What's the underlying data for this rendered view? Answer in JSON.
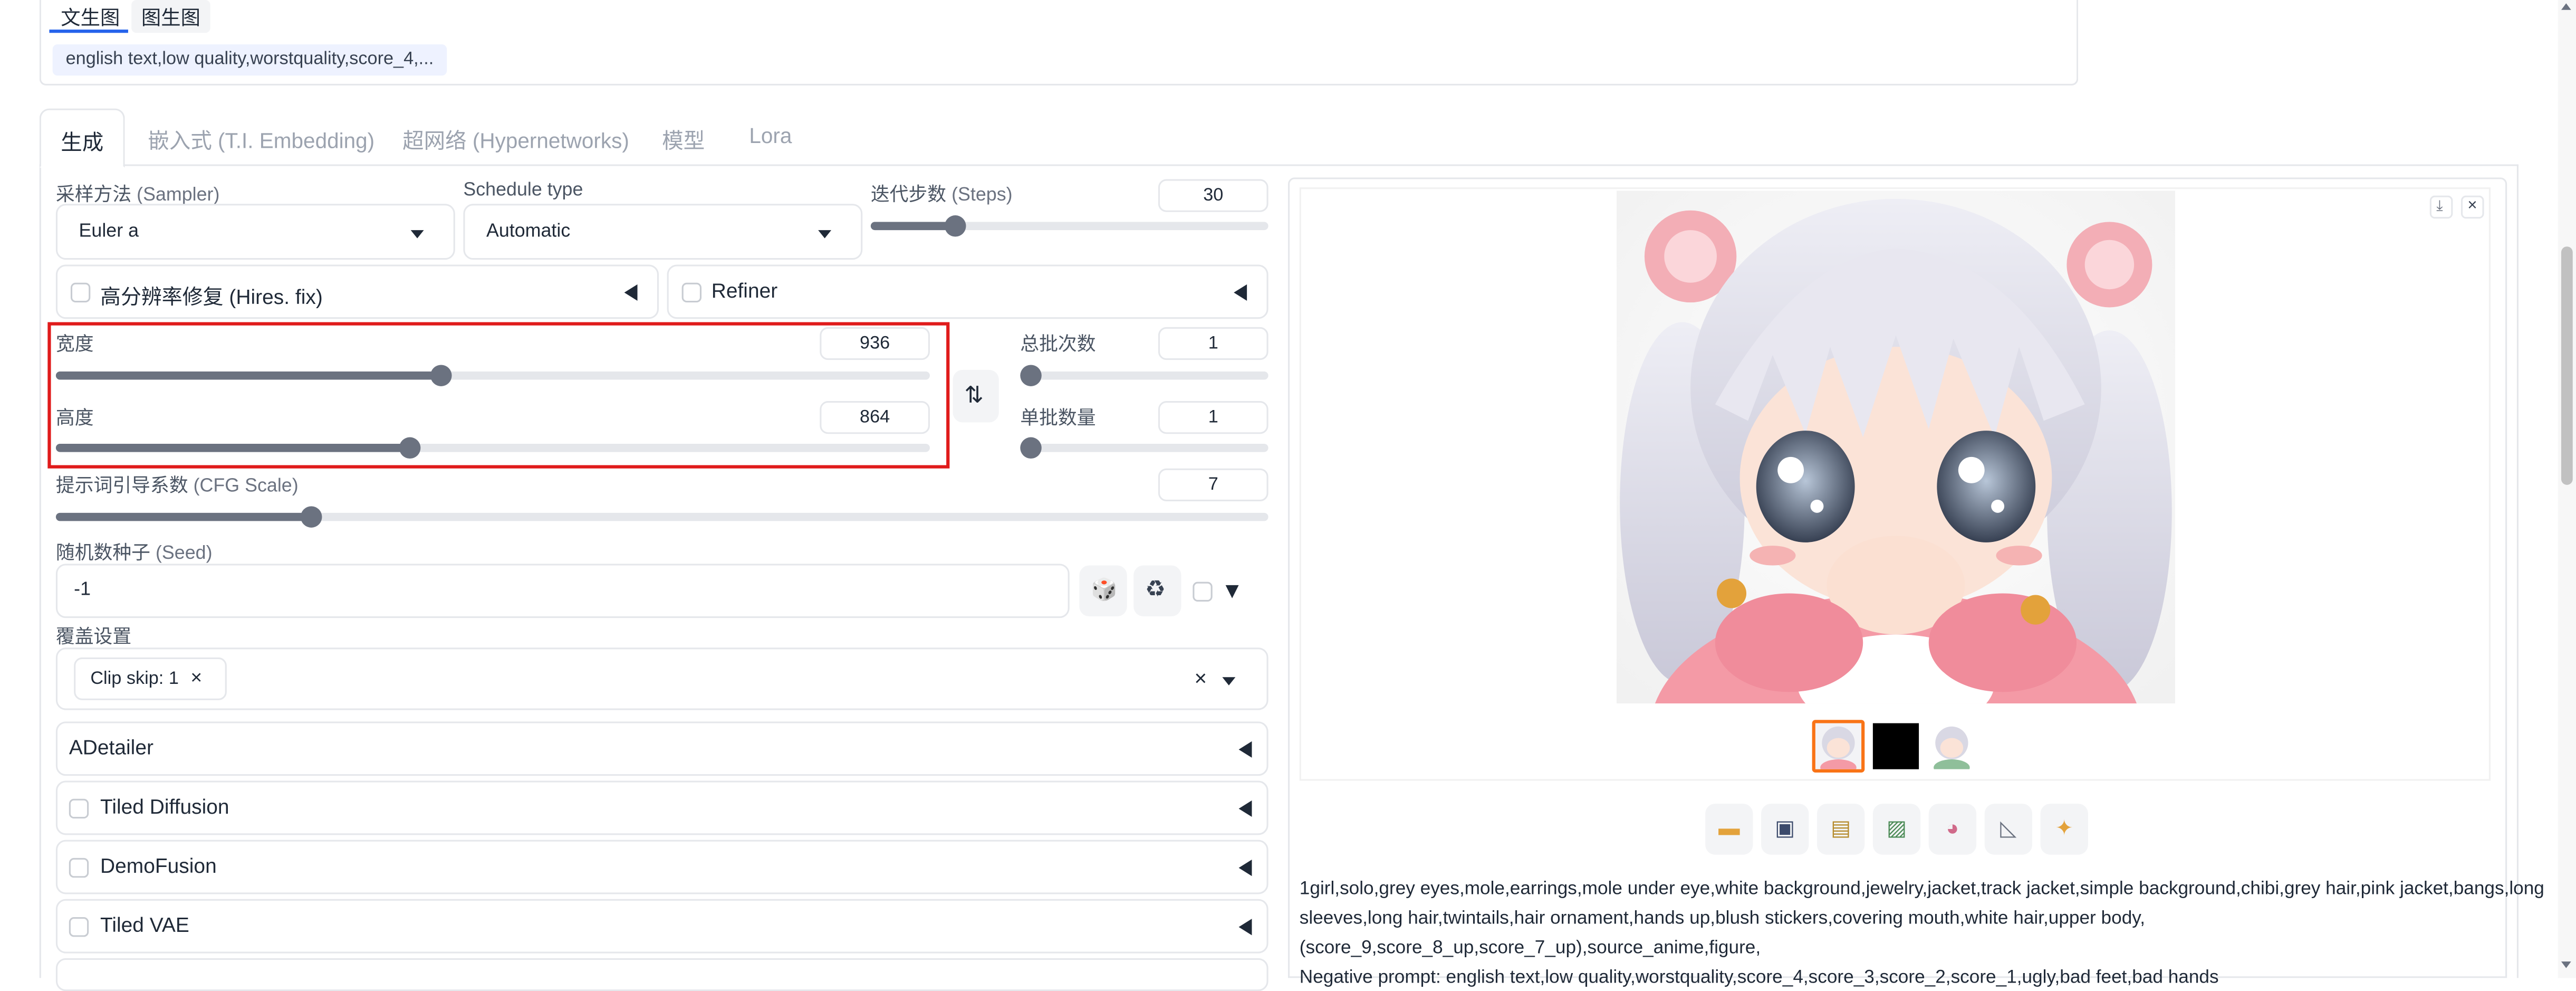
{
  "top_tabs": [
    "文生图",
    "图生图"
  ],
  "negative_chip": "english text,low quality,worstquality,score_4,...",
  "main_tabs": [
    "生成",
    "嵌入式 (T.I. Embedding)",
    "超网络 (Hypernetworks)",
    "模型",
    "Lora"
  ],
  "sampler": {
    "label_cn": "采样方法",
    "label_en": "(Sampler)",
    "value": "Euler a"
  },
  "schedule": {
    "label": "Schedule type",
    "value": "Automatic"
  },
  "steps": {
    "label_cn": "迭代步数",
    "label_en": "(Steps)",
    "value": "30"
  },
  "hires": {
    "label": "高分辨率修复 (Hires. fix)"
  },
  "refiner": {
    "label": "Refiner"
  },
  "width": {
    "label": "宽度",
    "value": "936",
    "fraction": 0.44
  },
  "height": {
    "label": "高度",
    "value": "864",
    "fraction": 0.405
  },
  "batch_count": {
    "label": "总批次数",
    "value": "1"
  },
  "batch_size": {
    "label": "单批数量",
    "value": "1"
  },
  "cfg": {
    "label_cn": "提示词引导系数",
    "label_en": "(CFG Scale)",
    "value": "7",
    "fraction": 0.21
  },
  "seed": {
    "label_cn": "随机数种子",
    "label_en": "(Seed)",
    "value": "-1"
  },
  "override": {
    "label": "覆盖设置",
    "chip": "Clip skip: 1"
  },
  "accordions": {
    "adetailer": "ADetailer",
    "tiled_diffusion": "Tiled Diffusion",
    "demofusion": "DemoFusion",
    "tiled_vae": "Tiled VAE"
  },
  "output_text": {
    "line1": "1girl,solo,grey eyes,mole,earrings,mole under eye,white background,jewelry,jacket,track jacket,simple background,chibi,grey hair,pink jacket,bangs,long",
    "line2": "sleeves,long hair,twintails,hair ornament,hands up,blush stickers,covering mouth,white hair,upper body,",
    "line3": "(score_9,score_8_up,score_7_up),source_anime,figure,",
    "line4": "Negative prompt: english text,low quality,worstquality,score_4,score_3,score_2,score_1,ugly,bad feet,bad hands"
  },
  "icons": {
    "swap": "swap-arrows-icon",
    "dice": "dice-icon",
    "recycle": "recycle-icon",
    "folder": "folder-icon",
    "save": "save-icon",
    "zip": "zip-icon",
    "img2img": "send-to-img2img-icon",
    "inpaint": "send-to-inpaint-icon",
    "extras": "send-to-extras-icon",
    "sparkle": "sparkle-icon"
  },
  "colors": {
    "accent": "#2563eb",
    "highlight": "#e01b1b",
    "selected_thumb": "#f97316"
  }
}
